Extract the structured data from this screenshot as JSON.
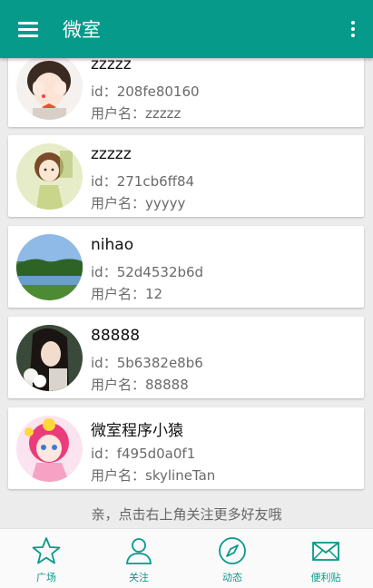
{
  "app": {
    "title": "微室",
    "accent": "#059a8a"
  },
  "contacts": [
    {
      "name": "zzzzz",
      "id_label": "id：",
      "id": "208fe80160",
      "username_label": "用户名：",
      "username": "zzzzz",
      "avatar": "girl-covering-face"
    },
    {
      "name": "zzzzz",
      "id_label": "id：",
      "id": "271cb6ff84",
      "username_label": "用户名：",
      "username": "yyyyy",
      "avatar": "cartoon-girl"
    },
    {
      "name": "nihao",
      "id_label": "id：",
      "id": "52d4532b6d",
      "username_label": "用户名：",
      "username": "12",
      "avatar": "landscape"
    },
    {
      "name": "88888",
      "id_label": "id：",
      "id": "5b6382e8b6",
      "username_label": "用户名：",
      "username": "88888",
      "avatar": "woman-with-flowers"
    },
    {
      "name": "微室程序小猿",
      "id_label": "id：",
      "id": "f495d0a0f1",
      "username_label": "用户名：",
      "username": "skylineTan",
      "avatar": "anime-girl"
    }
  ],
  "footer_tip": "亲，点击右上角关注更多好友哦",
  "bottom_nav": [
    {
      "label": "广场",
      "icon": "star-icon"
    },
    {
      "label": "关注",
      "icon": "person-icon"
    },
    {
      "label": "动态",
      "icon": "compass-icon"
    },
    {
      "label": "便利贴",
      "icon": "mail-icon"
    }
  ]
}
